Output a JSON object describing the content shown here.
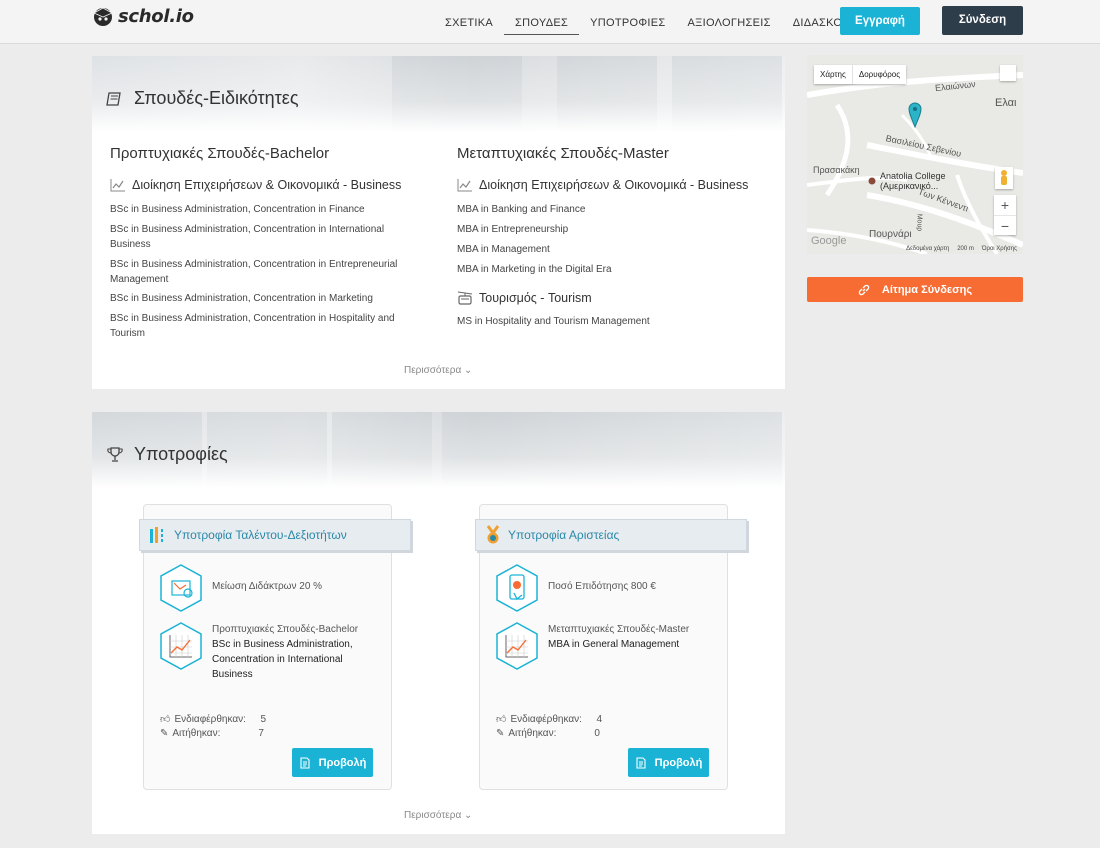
{
  "header": {
    "logo_text": "schol.io",
    "nav": [
      "ΣΧΕΤΙΚΑ",
      "ΣΠΟΥΔΕΣ",
      "ΥΠΟΤΡΟΦΙΕΣ",
      "ΑΞΙΟΛΟΓΗΣΕΙΣ",
      "ΔΙΔΑΣΚΟΝΤΕΣ"
    ],
    "active_nav": "ΣΠΟΥΔΕΣ",
    "register_label": "Εγγραφή",
    "login_label": "Σύνδεση"
  },
  "studies": {
    "title": "Σπουδές-Ειδικότητες",
    "bachelor": {
      "heading": "Προπτυχιακές Σπουδές-Bachelor",
      "category": "Διοίκηση Επιχειρήσεων & Οικονομικά - Business",
      "programs": [
        "BSc in Business Administration, Concentration in Finance",
        "BSc in Business Administration, Concentration in International Business",
        "BSc in Business Administration, Concentration in Entrepreneurial Management",
        "BSc in Business Administration, Concentration in Marketing",
        "BSc in Business Administration, Concentration in Hospitality and Tourism"
      ]
    },
    "master": {
      "heading": "Μεταπτυχιακές Σπουδές-Master",
      "category": "Διοίκηση Επιχειρήσεων & Οικονομικά - Business",
      "programs": [
        "MBA in Banking and Finance",
        "MBA in Entrepreneurship",
        "MBA in Management",
        "MBA in Marketing in the Digital Era"
      ],
      "category2": "Τουρισμός - Tourism",
      "programs2": [
        "MS in Hospitality and Tourism Management"
      ]
    },
    "more": "Περισσότερα"
  },
  "scholarships": {
    "title": "Υποτροφίες",
    "cards": [
      {
        "title": "Υποτροφία Ταλέντου-Δεξιοτήτων",
        "benefit": "Μείωση Διδάκτρων 20 %",
        "level": "Προπτυχιακές Σπουδές-Bachelor",
        "program": "BSc in Business Administration, Concentration in International Business",
        "interested_label": "Ενδιαφέρθηκαν:",
        "interested": "5",
        "requested_label": "Αιτήθηκαν:",
        "requested": "7",
        "view_label": "Προβολή"
      },
      {
        "title": "Υποτροφία Αριστείας",
        "benefit": "Ποσό Επιδότησης 800 €",
        "level": "Μεταπτυχιακές Σπουδές-Master",
        "program": "MBA in General Management",
        "interested_label": "Ενδιαφέρθηκαν:",
        "interested": "4",
        "requested_label": "Αιτήθηκαν:",
        "requested": "0",
        "view_label": "Προβολή"
      }
    ],
    "more": "Περισσότερα"
  },
  "map": {
    "map_label": "Χάρτης",
    "satellite_label": "Δορυφόρος",
    "place_line1": "Anatolia College",
    "place_line2": "(Αμερικανικό...",
    "streets": [
      "Ελαιώνων",
      "Ελαι",
      "Βασιλείου Σεβενίου",
      "Πρασακάκη",
      "Των Κέννεντι",
      "Πουρνάρι",
      "Μουρ"
    ],
    "footer": [
      "Δεδομένα χάρτη",
      "200 m",
      "Όροι Χρήσης"
    ],
    "google": "Google"
  },
  "request_label": "Αίτημα Σύνδεσης",
  "colors": {
    "accent": "#1ab3d6",
    "dark": "#2e3d4a",
    "orange": "#f76c33",
    "ribbon_text": "#2a88a8"
  }
}
